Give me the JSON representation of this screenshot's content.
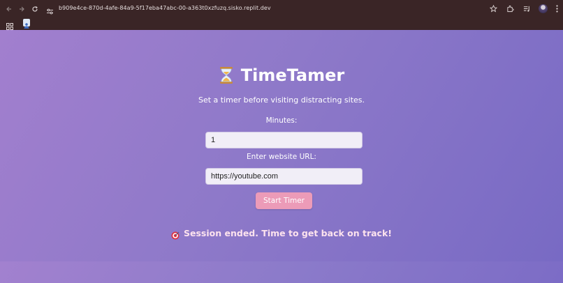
{
  "browser": {
    "url": "b909e4ce-870d-4afe-84a9-5f17eba47abc-00-a363t0xzfuzq.sisko.replit.dev"
  },
  "app": {
    "title": "TimeTamer",
    "title_icon": "hourglass-icon",
    "subtitle": "Set a timer before visiting distracting sites.",
    "minutes_label": "Minutes:",
    "minutes_value": "1",
    "url_label": "Enter website URL:",
    "url_value": "https://youtube.com",
    "start_button": "Start Timer",
    "status_icon": "target-icon",
    "status_message": "Session ended. Time to get back on track!"
  },
  "colors": {
    "accent_button": "#ec9bb8",
    "status_text": "#fde3ee",
    "background_start": "#a27fce",
    "background_end": "#786ac4"
  }
}
